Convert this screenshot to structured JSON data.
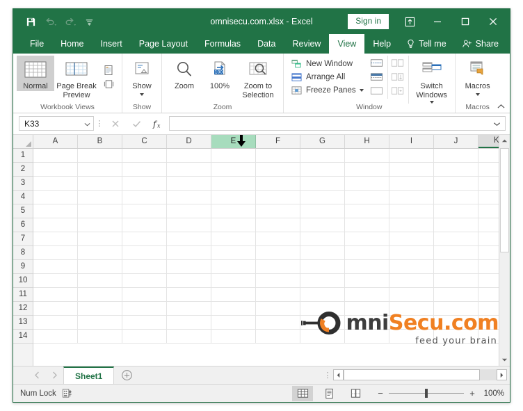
{
  "window": {
    "title": "omnisecu.com.xlsx  -  Excel",
    "sign_in_label": "Sign in",
    "quick_access": [
      {
        "name": "save-icon",
        "label": "Save"
      },
      {
        "name": "undo-icon",
        "label": "Undo"
      },
      {
        "name": "redo-icon",
        "label": "Redo"
      },
      {
        "name": "customize-qat-icon",
        "label": "Customize Quick Access Toolbar"
      }
    ],
    "controls": [
      {
        "name": "ribbon-display-options-button",
        "label": "Ribbon Display Options"
      },
      {
        "name": "minimize-button",
        "label": "Minimize"
      },
      {
        "name": "maximize-button",
        "label": "Maximize"
      },
      {
        "name": "close-button",
        "label": "Close"
      }
    ]
  },
  "tabs": [
    {
      "label": "File",
      "active": false
    },
    {
      "label": "Home",
      "active": false
    },
    {
      "label": "Insert",
      "active": false
    },
    {
      "label": "Page Layout",
      "active": false
    },
    {
      "label": "Formulas",
      "active": false
    },
    {
      "label": "Data",
      "active": false
    },
    {
      "label": "Review",
      "active": false
    },
    {
      "label": "View",
      "active": true
    },
    {
      "label": "Help",
      "active": false
    },
    {
      "label": "Tell me",
      "active": false
    },
    {
      "label": "Share",
      "active": false
    }
  ],
  "ribbon": {
    "groups": [
      {
        "label": "Workbook Views",
        "buttons": [
          {
            "label": "Normal",
            "selected": true
          },
          {
            "label": "Page Break Preview",
            "selected": false
          },
          {
            "label": "Page Layout",
            "selected": false
          },
          {
            "label": "Custom Views",
            "selected": false
          }
        ]
      },
      {
        "label": "Show",
        "buttons": [
          {
            "label": "Show",
            "selected": false
          }
        ]
      },
      {
        "label": "Zoom",
        "buttons": [
          {
            "label": "Zoom",
            "selected": false
          },
          {
            "label": "100%",
            "selected": false
          },
          {
            "label": "Zoom to Selection",
            "selected": false
          }
        ]
      },
      {
        "label": "Window",
        "buttons": [
          {
            "label": "New Window"
          },
          {
            "label": "Arrange All"
          },
          {
            "label": "Freeze Panes"
          },
          {
            "label": "Split"
          },
          {
            "label": "Hide"
          },
          {
            "label": "Unhide"
          },
          {
            "label": "View Side by Side"
          },
          {
            "label": "Synchronous Scrolling"
          },
          {
            "label": "Reset Window Position"
          },
          {
            "label": "Switch Windows"
          }
        ]
      },
      {
        "label": "Macros",
        "buttons": [
          {
            "label": "Macros",
            "selected": false
          }
        ]
      }
    ],
    "collapse_label": "Collapse the Ribbon"
  },
  "formula_bar": {
    "name_box_value": "K33",
    "formula_value": "",
    "cancel_label": "Cancel",
    "enter_label": "Enter",
    "insert_function_label": "fx"
  },
  "grid": {
    "columns": [
      "A",
      "B",
      "C",
      "D",
      "E",
      "F",
      "G",
      "H",
      "I",
      "J",
      "K"
    ],
    "selected_column": "E",
    "rows": [
      "1",
      "2",
      "3",
      "4",
      "5",
      "6",
      "7",
      "8",
      "9",
      "10",
      "11",
      "12",
      "13",
      "14"
    ]
  },
  "logo": {
    "part_dark": "mni",
    "part_orange": "Secu.com",
    "tagline": "feed your brain"
  },
  "sheet_bar": {
    "sheets": [
      {
        "label": "Sheet1",
        "active": true
      }
    ],
    "add_sheet_label": "New sheet",
    "prev_label": "Previous sheet",
    "next_label": "Next sheet"
  },
  "status_bar": {
    "status_text": "Num Lock",
    "accessibility_label": "Accessibility checker",
    "views": [
      {
        "name": "normal-view-button",
        "label": "Normal",
        "active": true
      },
      {
        "name": "page-layout-view-button",
        "label": "Page Layout",
        "active": false
      },
      {
        "name": "page-break-preview-button",
        "label": "Page Break Preview",
        "active": false
      }
    ],
    "zoom_out_label": "−",
    "zoom_in_label": "+",
    "zoom_level": "100%"
  },
  "colors": {
    "excel_green": "#217346",
    "selection_green": "#a7dcbd",
    "logo_orange": "#f08022"
  }
}
